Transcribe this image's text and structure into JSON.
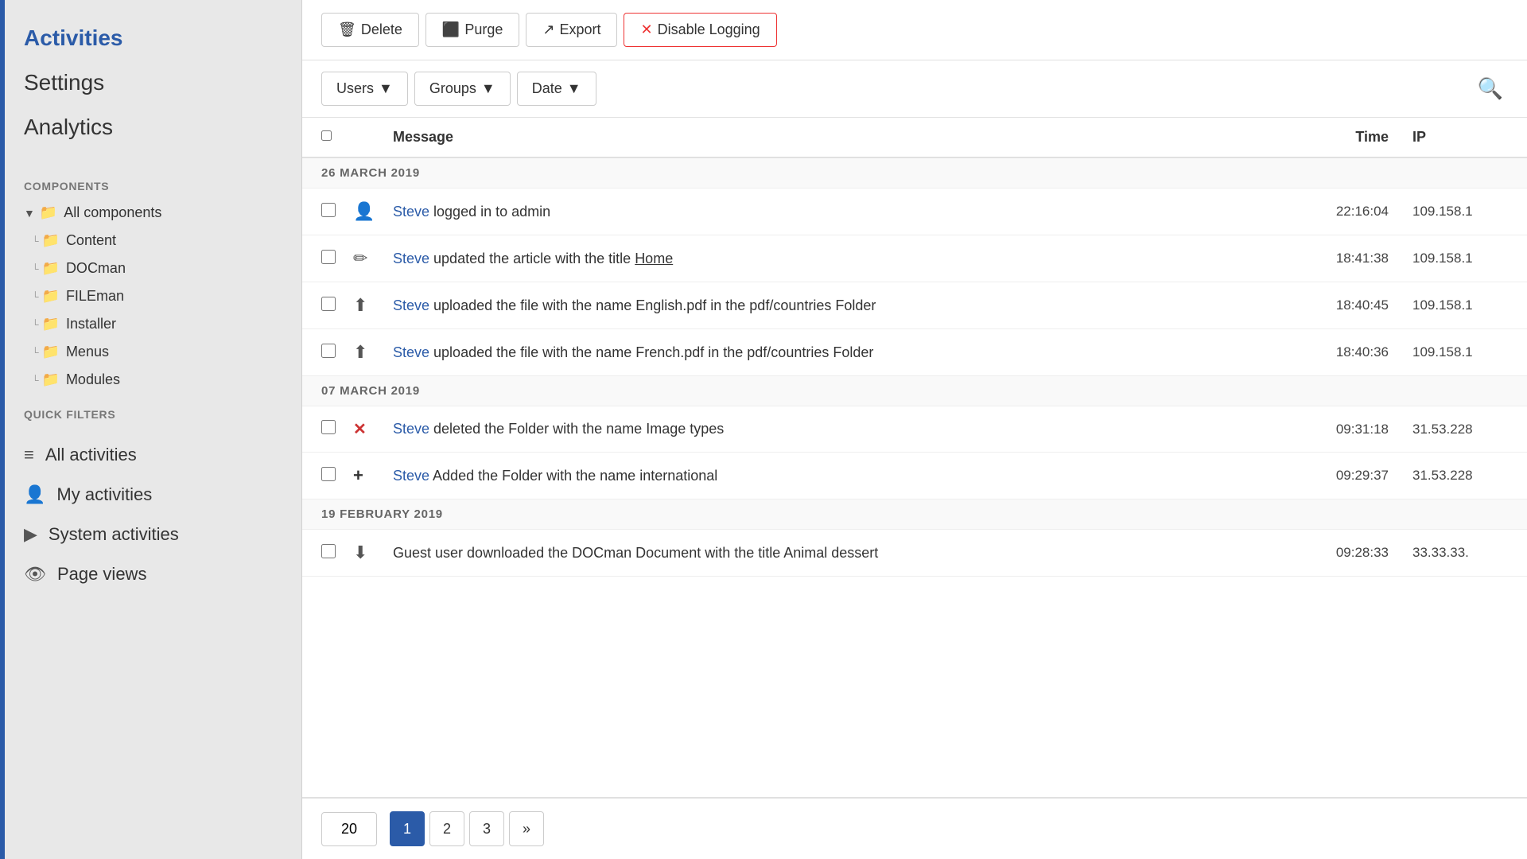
{
  "sidebar": {
    "accent_color": "#2b5ba8",
    "nav_items": [
      {
        "label": "Activities",
        "active": true
      },
      {
        "label": "Settings",
        "active": false
      },
      {
        "label": "Analytics",
        "active": false
      }
    ],
    "components_label": "Components",
    "components": [
      {
        "label": "All components",
        "level": 0,
        "has_arrow": true
      },
      {
        "label": "Content",
        "level": 1
      },
      {
        "label": "DOCman",
        "level": 1
      },
      {
        "label": "FILEman",
        "level": 1
      },
      {
        "label": "Installer",
        "level": 1
      },
      {
        "label": "Menus",
        "level": 1
      },
      {
        "label": "Modules",
        "level": 1
      }
    ],
    "quick_filters_label": "Quick Filters",
    "quick_filters": [
      {
        "label": "All activities",
        "icon": "≡"
      },
      {
        "label": "My activities",
        "icon": "👤"
      },
      {
        "label": "System activities",
        "icon": "▶"
      },
      {
        "label": "Page views",
        "icon": "👁"
      }
    ]
  },
  "toolbar": {
    "delete_label": "Delete",
    "purge_label": "Purge",
    "export_label": "Export",
    "disable_logging_label": "Disable Logging"
  },
  "filters": {
    "users_label": "Users",
    "groups_label": "Groups",
    "date_label": "Date"
  },
  "table": {
    "col_message": "Message",
    "col_time": "Time",
    "col_ip": "IP",
    "date_groups": [
      {
        "date": "26 MARCH 2019",
        "rows": [
          {
            "icon": "👤",
            "message_parts": [
              {
                "type": "link",
                "text": "Steve"
              },
              {
                "type": "text",
                "text": " logged in to admin"
              }
            ],
            "time": "22:16:04",
            "ip": "109.158.1"
          },
          {
            "icon": "✏",
            "message_parts": [
              {
                "type": "link",
                "text": "Steve"
              },
              {
                "type": "text",
                "text": " updated the article with the title "
              },
              {
                "type": "underline",
                "text": "Home"
              }
            ],
            "time": "18:41:38",
            "ip": "109.158.1"
          },
          {
            "icon": "⬆",
            "message_parts": [
              {
                "type": "link",
                "text": "Steve"
              },
              {
                "type": "text",
                "text": " uploaded the file with the name English.pdf in the pdf/countries Folder"
              }
            ],
            "time": "18:40:45",
            "ip": "109.158.1"
          },
          {
            "icon": "⬆",
            "message_parts": [
              {
                "type": "link",
                "text": "Steve"
              },
              {
                "type": "text",
                "text": " uploaded the file with the name French.pdf in the pdf/countries Folder"
              }
            ],
            "time": "18:40:36",
            "ip": "109.158.1"
          }
        ]
      },
      {
        "date": "07 MARCH 2019",
        "rows": [
          {
            "icon": "✕",
            "message_parts": [
              {
                "type": "link",
                "text": "Steve"
              },
              {
                "type": "text",
                "text": " deleted the Folder with the name Image types"
              }
            ],
            "time": "09:31:18",
            "ip": "31.53.228"
          },
          {
            "icon": "+",
            "message_parts": [
              {
                "type": "link",
                "text": "Steve"
              },
              {
                "type": "text",
                "text": " Added the Folder with the name international"
              }
            ],
            "time": "09:29:37",
            "ip": "31.53.228"
          }
        ]
      },
      {
        "date": "19 FEBRUARY 2019",
        "rows": [
          {
            "icon": "⬇",
            "message_parts": [
              {
                "type": "text",
                "text": "Guest user downloaded the DOCman Document with the title Animal dessert"
              }
            ],
            "time": "09:28:33",
            "ip": "33.33.33."
          }
        ]
      }
    ]
  },
  "pagination": {
    "page_size": "20",
    "pages": [
      "1",
      "2",
      "3",
      "»"
    ],
    "active_page": "1"
  }
}
